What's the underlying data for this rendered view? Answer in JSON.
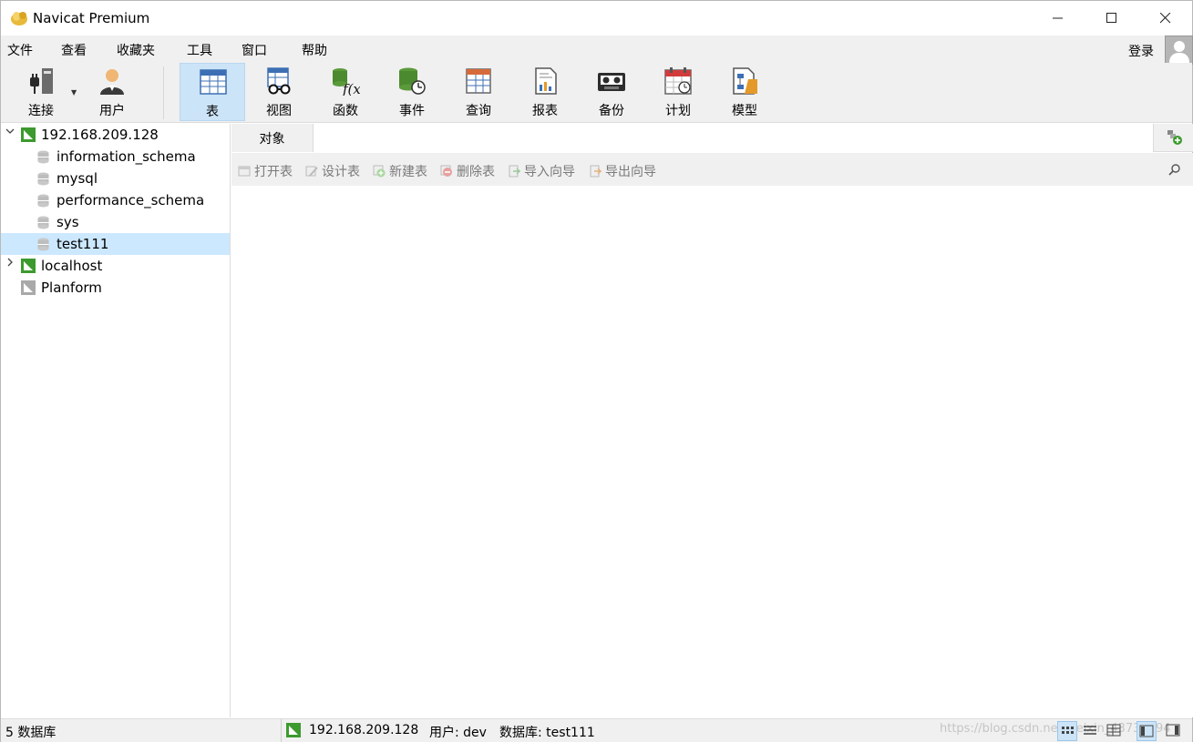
{
  "window": {
    "title": "Navicat Premium"
  },
  "menu": {
    "items": [
      "文件",
      "查看",
      "收藏夹",
      "工具",
      "窗口",
      "帮助"
    ],
    "login": "登录"
  },
  "toolbar": {
    "connect": "连接",
    "user": "用户",
    "tools": [
      "表",
      "视图",
      "函数",
      "事件",
      "查询",
      "报表",
      "备份",
      "计划",
      "模型"
    ],
    "active_tool": "表"
  },
  "tree": {
    "connections": [
      {
        "name": "192.168.209.128",
        "expanded": true,
        "databases": [
          "information_schema",
          "mysql",
          "performance_schema",
          "sys",
          "test111"
        ],
        "selected_database": "test111"
      },
      {
        "name": "localhost",
        "expanded": false
      },
      {
        "name": "Planform",
        "expanded": false
      }
    ]
  },
  "object_tab": {
    "label": "对象"
  },
  "object_toolbar": {
    "open": "打开表",
    "design": "设计表",
    "new": "新建表",
    "delete": "删除表",
    "import": "导入向导",
    "export": "导出向导"
  },
  "status": {
    "db_count": "5 数据库",
    "connection": "192.168.209.128",
    "user": "用户: dev",
    "database": "数据库: test111",
    "watermark": "https://blog.csdn.net/weixin_43732194"
  },
  "colors": {
    "accent_selected": "#cce8ff",
    "toolbar_active": "#cce4f7",
    "mysql_green": "#3c9a2e"
  }
}
